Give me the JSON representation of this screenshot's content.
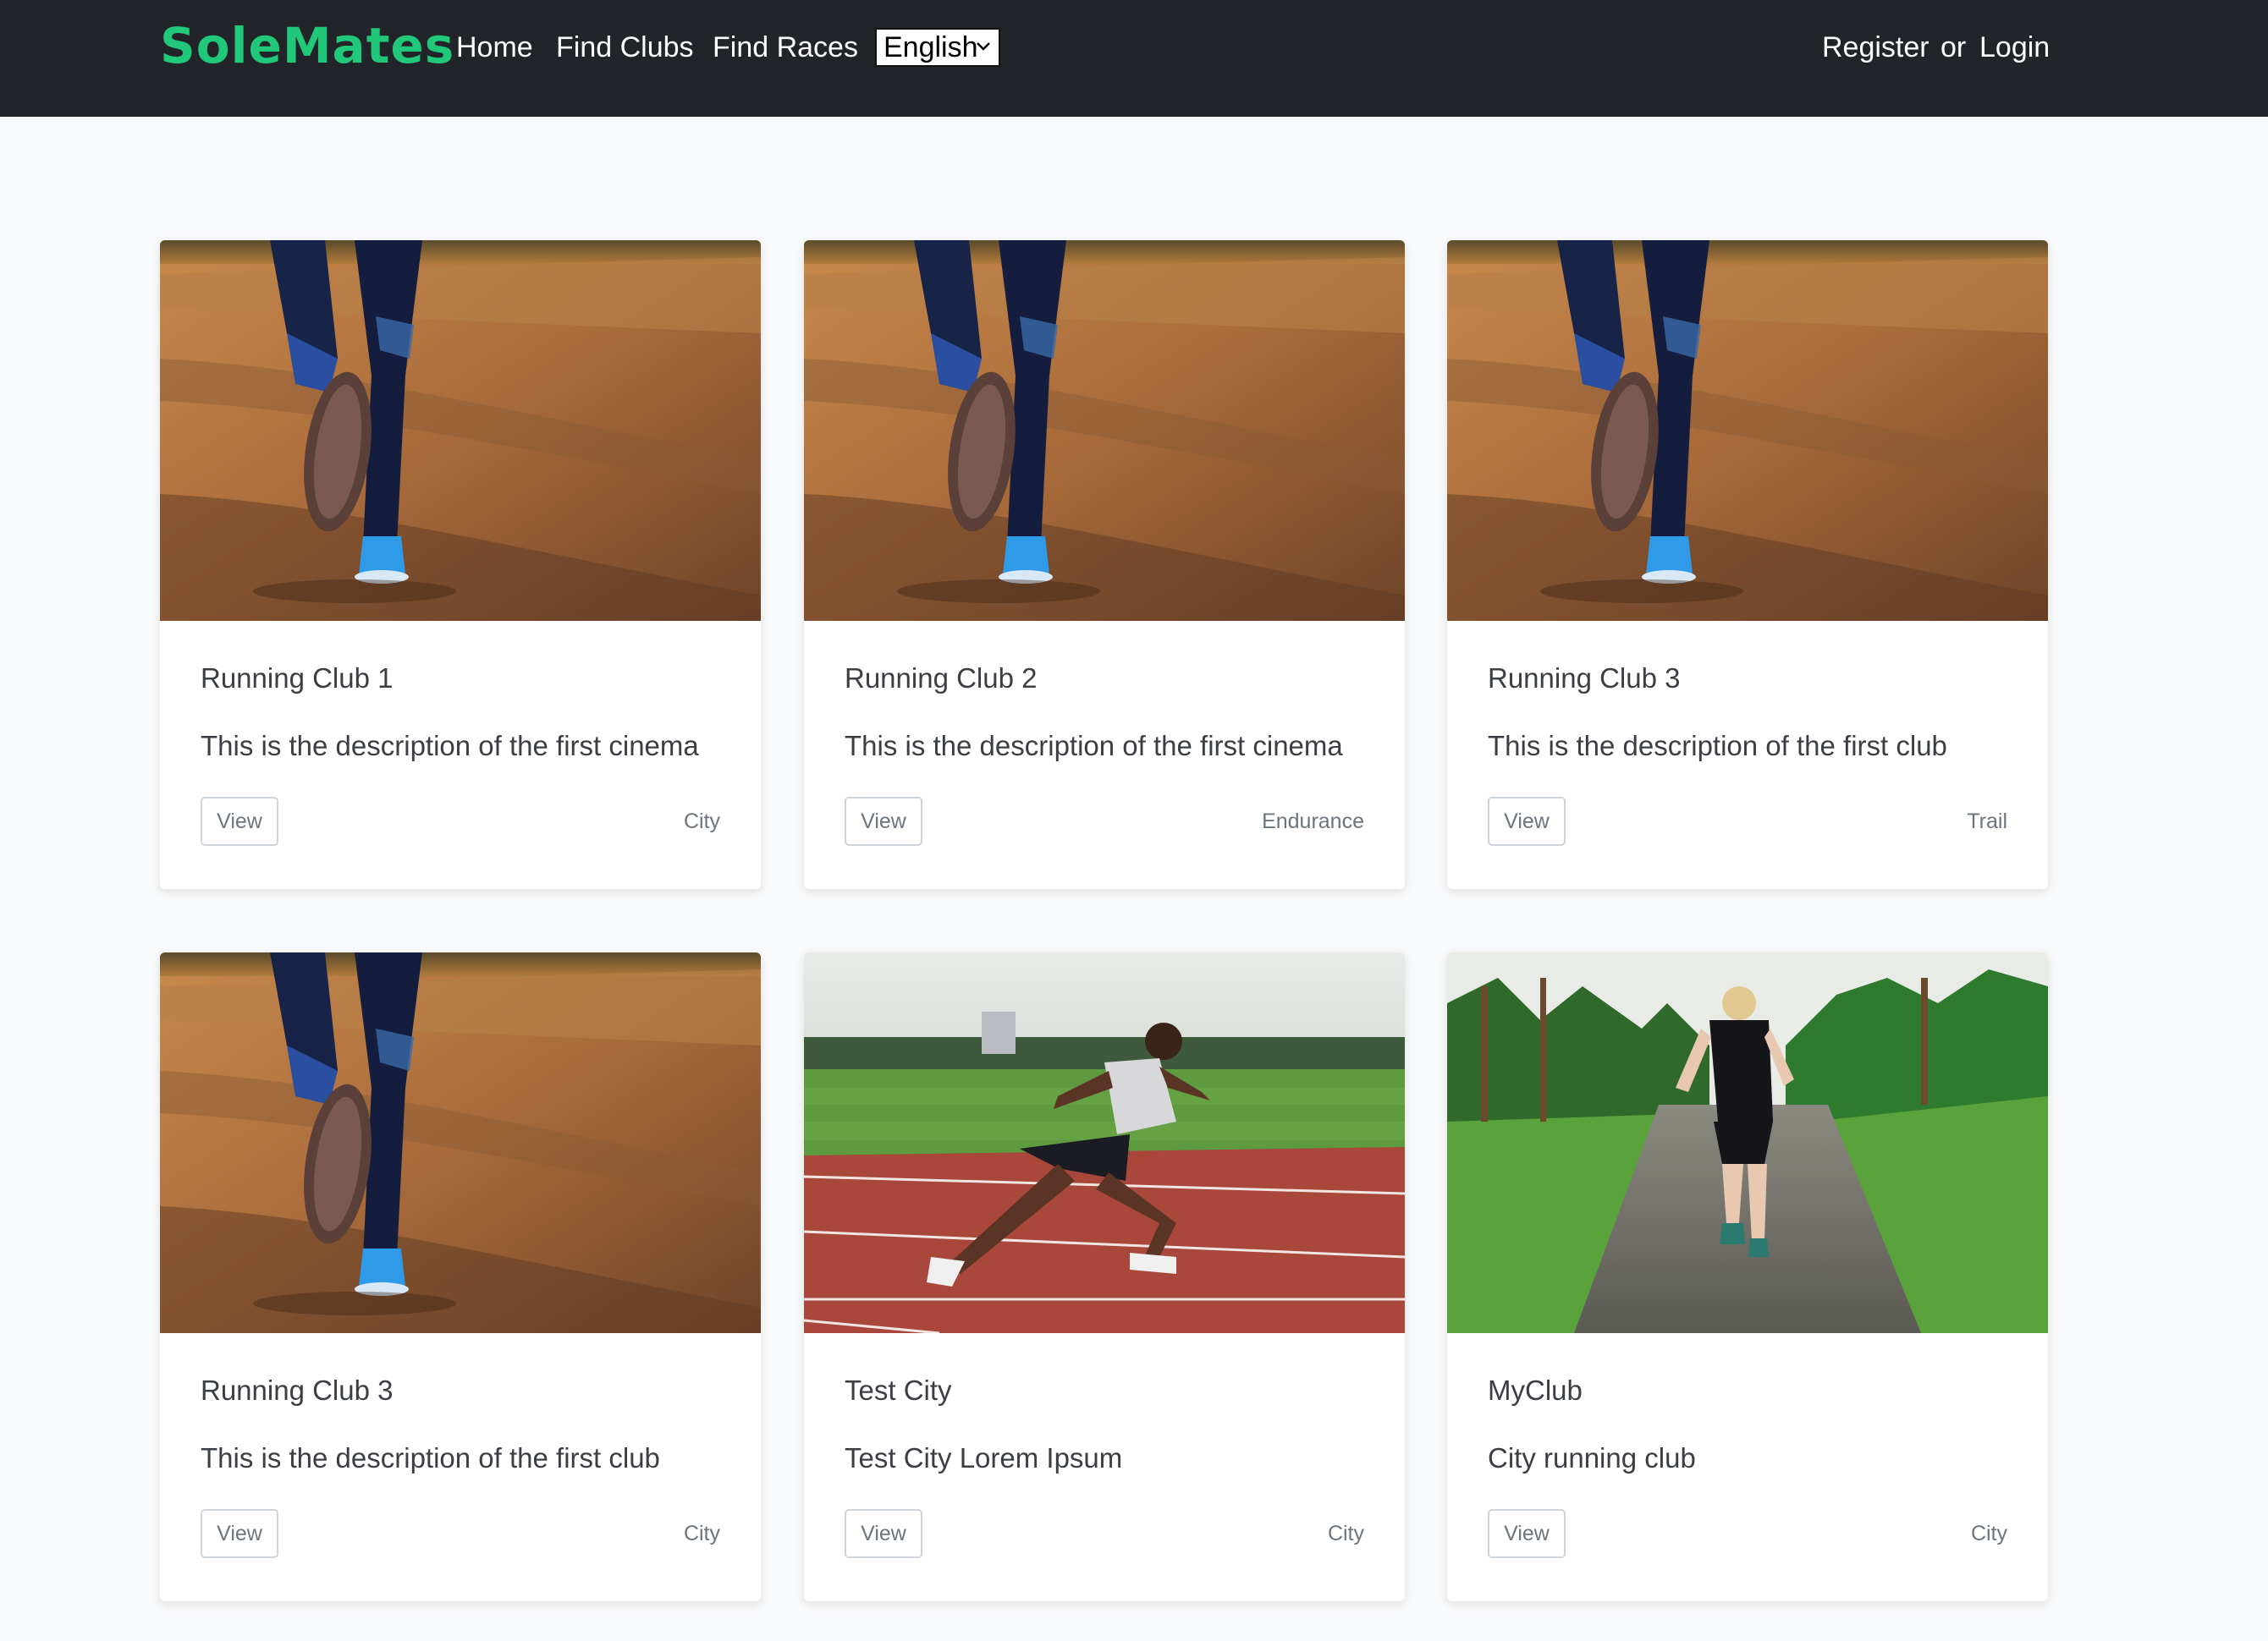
{
  "nav": {
    "brand": "SoleMates",
    "links": [
      "Home",
      "Find Clubs",
      "Find Races"
    ],
    "language": "English",
    "register": "Register",
    "or": "or",
    "login": "Login"
  },
  "cards": [
    {
      "title": "Running Club 1",
      "description": "This is the description of the first cinema",
      "button": "View",
      "tag": "City",
      "image": "dirt-road-runner-image"
    },
    {
      "title": "Running Club 2",
      "description": "This is the description of the first cinema",
      "button": "View",
      "tag": "Endurance",
      "image": "dirt-road-runner-image"
    },
    {
      "title": "Running Club 3",
      "description": "This is the description of the first club",
      "button": "View",
      "tag": "Trail",
      "image": "dirt-road-runner-image"
    },
    {
      "title": "Running Club 3",
      "description": "This is the description of the first club",
      "button": "View",
      "tag": "City",
      "image": "dirt-road-runner-image"
    },
    {
      "title": "Test City",
      "description": "Test City Lorem Ipsum",
      "button": "View",
      "tag": "City",
      "image": "track-sprinter-image"
    },
    {
      "title": "MyClub",
      "description": "City running club",
      "button": "View",
      "tag": "City",
      "image": "forest-path-runner-image"
    }
  ],
  "colors": {
    "navbar": "#212529",
    "brand": "#21c87a",
    "page_bg": "#f8f9fa"
  }
}
